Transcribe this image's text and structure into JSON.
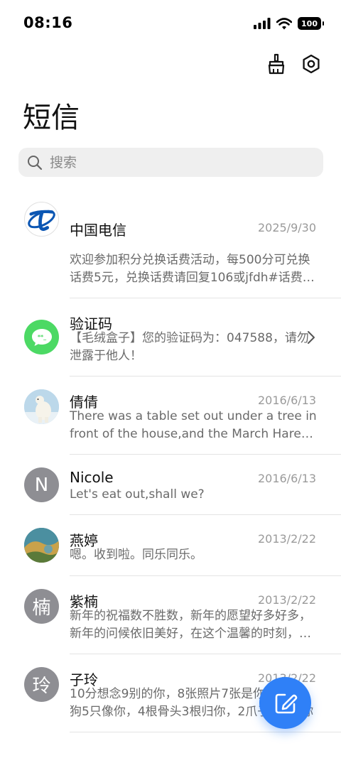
{
  "status_bar": {
    "time": "08:16",
    "battery": "100"
  },
  "header": {
    "title": "短信"
  },
  "search": {
    "placeholder": "搜索"
  },
  "conversations": [
    {
      "sender": "中国电信",
      "date": "2025/9/30",
      "preview": "欢迎参加积分兑换话费活动，每500分可兑换话费5元，兑换话费请回复106或jfdh#话费金额"
    },
    {
      "sender": "验证码",
      "date": "",
      "preview": "【毛绒盒子】您的验证码为：047588，请勿泄露于他人！"
    },
    {
      "sender": "倩倩",
      "date": "2016/6/13",
      "preview": "There was a table set out under a tree in front of the house,and the March Hare and the Hatter were having tea"
    },
    {
      "sender": "Nicole",
      "date": "2016/6/13",
      "preview": "Let's eat out,shall we?",
      "initial": "N"
    },
    {
      "sender": "燕婷",
      "date": "2013/2/22",
      "preview": "嗯。收到啦。同乐同乐。"
    },
    {
      "sender": "紫楠",
      "date": "2013/2/22",
      "preview": "新年的祝福数不胜数，新年的愿望好多好多，新年的问候依旧美好，在这个温馨的时刻，祝你新年快乐",
      "initial": "楠"
    },
    {
      "sender": "子玲",
      "date": "2013/2/22",
      "preview": "10分想念9别的你，8张照片7张是你，6只小狗5只像你，4根骨头3根归你，2爪子1个是你",
      "initial": "玲"
    }
  ],
  "colors": {
    "accent": "#2f80f7",
    "telecom_blue": "#0b56b3",
    "verify_green": "#4cd964",
    "letter_avatar": "#8e8e93"
  }
}
